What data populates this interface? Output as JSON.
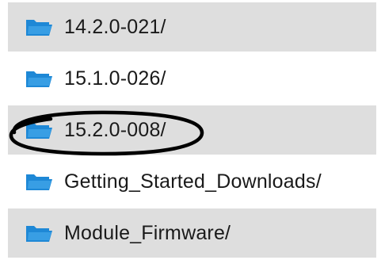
{
  "listing": {
    "items": [
      {
        "label": "14.2.0-021/",
        "icon": "folder-open-icon",
        "shaded": true
      },
      {
        "label": "15.1.0-026/",
        "icon": "folder-open-icon",
        "shaded": false
      },
      {
        "label": "15.2.0-008/",
        "icon": "folder-open-icon",
        "shaded": true,
        "circled": true
      },
      {
        "label": "Getting_Started_Downloads/",
        "icon": "folder-open-icon",
        "shaded": false
      },
      {
        "label": "Module_Firmware/",
        "icon": "folder-open-icon",
        "shaded": true
      }
    ]
  },
  "colors": {
    "folder_blue": "#1e88d6",
    "folder_light": "#4fb0f0",
    "row_shade": "#dedede",
    "annotation": "#000000"
  }
}
